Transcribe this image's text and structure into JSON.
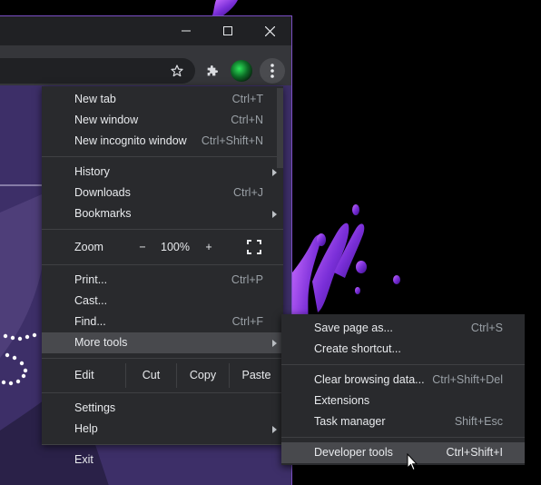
{
  "window": {
    "minimize_icon": "minimize-icon",
    "maximize_icon": "maximize-icon",
    "close_icon": "close-icon"
  },
  "toolbar": {
    "bookmark_icon": "star-icon",
    "extensions_icon": "puzzle-icon",
    "menu_icon": "kebab-menu-icon"
  },
  "menu": {
    "new_tab": {
      "label": "New tab",
      "shortcut": "Ctrl+T"
    },
    "new_window": {
      "label": "New window",
      "shortcut": "Ctrl+N"
    },
    "new_incognito": {
      "label": "New incognito window",
      "shortcut": "Ctrl+Shift+N"
    },
    "history": {
      "label": "History"
    },
    "downloads": {
      "label": "Downloads",
      "shortcut": "Ctrl+J"
    },
    "bookmarks": {
      "label": "Bookmarks"
    },
    "zoom": {
      "label": "Zoom",
      "minus": "−",
      "value": "100%",
      "plus": "+"
    },
    "print": {
      "label": "Print...",
      "shortcut": "Ctrl+P"
    },
    "cast": {
      "label": "Cast..."
    },
    "find": {
      "label": "Find...",
      "shortcut": "Ctrl+F"
    },
    "more_tools": {
      "label": "More tools"
    },
    "edit": {
      "label": "Edit",
      "cut": "Cut",
      "copy": "Copy",
      "paste": "Paste"
    },
    "settings": {
      "label": "Settings"
    },
    "help": {
      "label": "Help"
    },
    "exit": {
      "label": "Exit"
    }
  },
  "submenu": {
    "save_page": {
      "label": "Save page as...",
      "shortcut": "Ctrl+S"
    },
    "create_shortcut": {
      "label": "Create shortcut..."
    },
    "clear_browsing": {
      "label": "Clear browsing data...",
      "shortcut": "Ctrl+Shift+Del"
    },
    "extensions": {
      "label": "Extensions"
    },
    "task_manager": {
      "label": "Task manager",
      "shortcut": "Shift+Esc"
    },
    "developer_tools": {
      "label": "Developer tools",
      "shortcut": "Ctrl+Shift+I"
    }
  },
  "colors": {
    "menu_bg": "#292a2d",
    "highlight": "#48494d",
    "window_border": "#7b4fc4",
    "page_bg": "#3a2d62"
  }
}
